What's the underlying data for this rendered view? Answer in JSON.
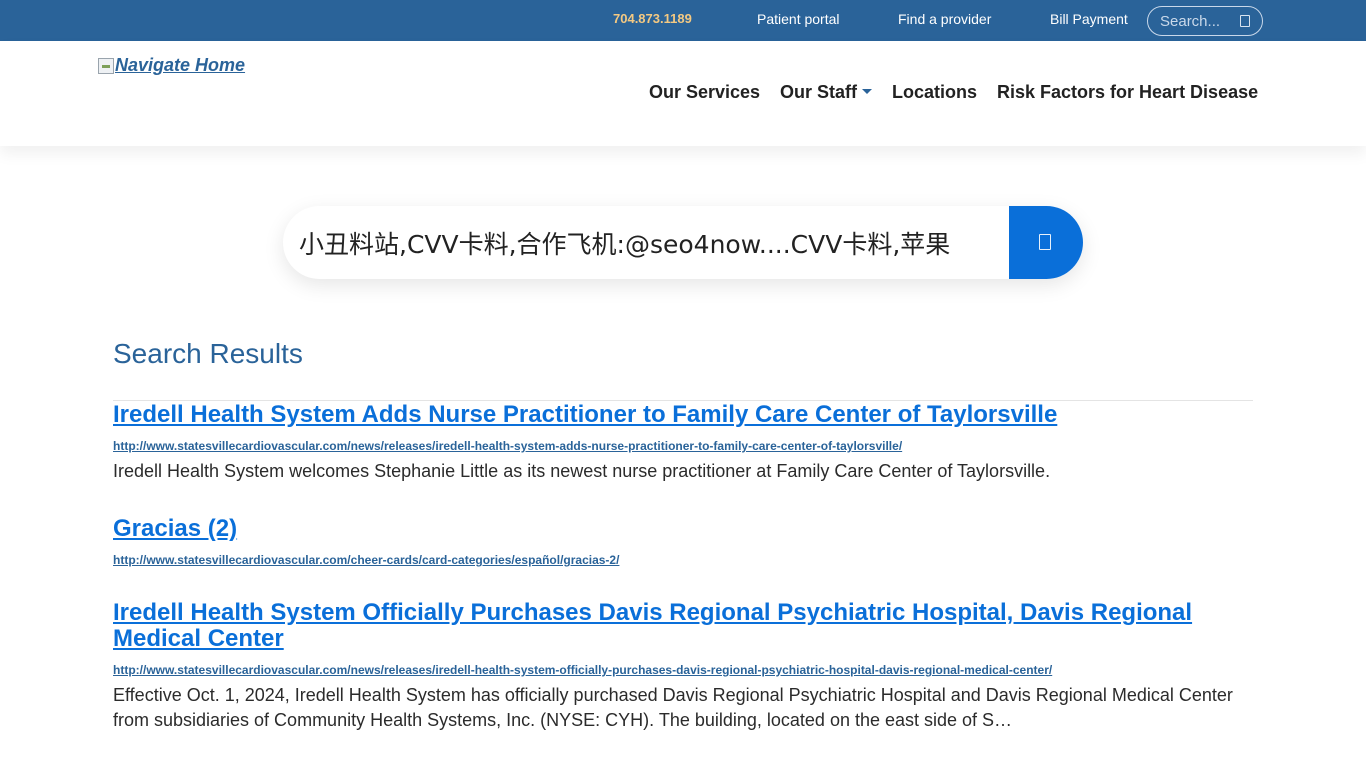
{
  "topbar": {
    "phone": "704.873.1189",
    "links": [
      "Patient portal",
      "Find a provider",
      "Bill Payment"
    ],
    "search_placeholder": "Search..."
  },
  "header": {
    "logo_alt": "Navigate Home",
    "nav": [
      "Our Services",
      "Our Staff",
      "Locations",
      "Risk Factors for Heart Disease"
    ]
  },
  "search": {
    "query": "小丑料站,CVV卡料,合作飞机:@seo4now....CVV卡料,苹果"
  },
  "results": {
    "heading": "Search Results",
    "items": [
      {
        "title": "Iredell Health System Adds Nurse Practitioner to Family Care Center of Taylorsville",
        "url": "http://www.statesvillecardiovascular.com/news/releases/iredell-health-system-adds-nurse-practitioner-to-family-care-center-of-taylorsville/",
        "description": "Iredell Health System welcomes Stephanie Little as its newest nurse practitioner at Family Care Center of Taylorsville."
      },
      {
        "title": "Gracias (2)",
        "url": "http://www.statesvillecardiovascular.com/cheer-cards/card-categories/español/gracias-2/",
        "description": ""
      },
      {
        "title": "Iredell Health System Officially Purchases Davis Regional Psychiatric Hospital, Davis Regional Medical Center",
        "url": "http://www.statesvillecardiovascular.com/news/releases/iredell-health-system-officially-purchases-davis-regional-psychiatric-hospital-davis-regional-medical-center/",
        "description": "Effective Oct. 1, 2024, Iredell Health System has officially purchased Davis Regional Psychiatric Hospital and Davis Regional Medical Center from subsidiaries of Community Health Systems, Inc. (NYSE: CYH). The building, located on the east side of S…"
      }
    ]
  },
  "colors": {
    "topbar_bg": "#2a6399",
    "phone": "#f4c982",
    "link_blue": "#0a6fd9",
    "heading_blue": "#2a6399"
  }
}
